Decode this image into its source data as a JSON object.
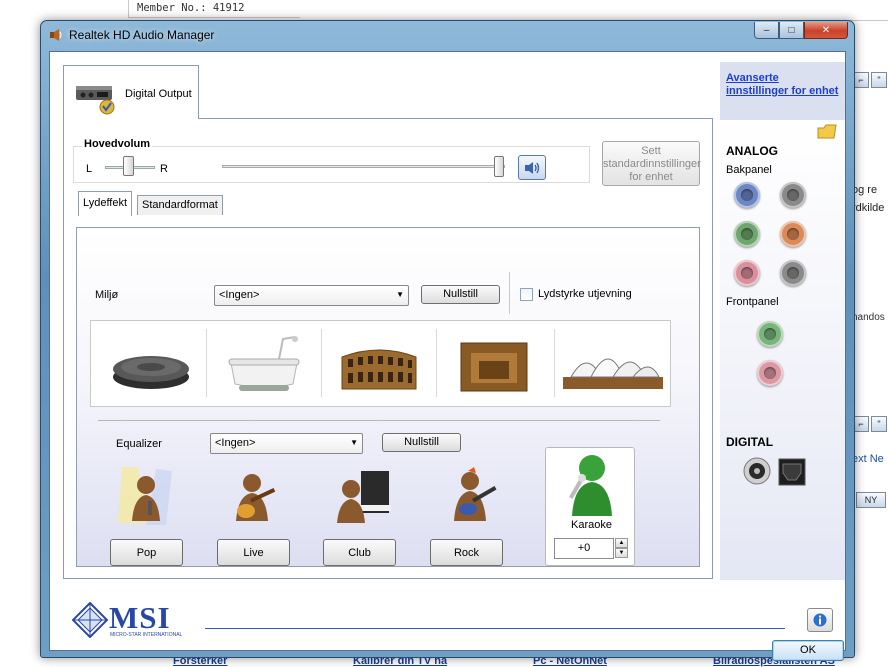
{
  "background_page": {
    "member_text": "Member No.: 41912",
    "right_fragments": [
      "og re",
      "rdkilde",
      "nandos",
      "ext Ne",
      "NY"
    ],
    "footer_links": [
      "Forsterker",
      "Kalibrer din TV nå",
      "Pc - NetOnNet",
      "Bilradiospesialisten AS"
    ]
  },
  "window": {
    "title": "Realtek HD Audio Manager",
    "caption_minimize": "–",
    "caption_maximize": "□",
    "caption_close": "✕"
  },
  "device": {
    "tab_label": "Digital Output"
  },
  "volume": {
    "legend": "Hovedvolum",
    "left_label": "L",
    "right_label": "R",
    "balance_level": 0.5,
    "master_level": 1.0,
    "set_default_button": "Sett standardinnstillinger for enhet"
  },
  "tabs": {
    "effect": "Lydeffekt",
    "format": "Standardformat"
  },
  "environment": {
    "label": "Miljø",
    "value": "<Ingen>",
    "reset_button": "Nullstill",
    "loudness_label": "Lydstyrke utjevning",
    "loudness_checked": false,
    "presets": [
      "disc-stone",
      "bathtub",
      "colosseum",
      "stone-room",
      "opera-house"
    ]
  },
  "equalizer": {
    "label": "Equalizer",
    "value": "<Ingen>",
    "reset_button": "Nullstill",
    "presets": [
      "Pop",
      "Live",
      "Club",
      "Rock"
    ]
  },
  "karaoke": {
    "label": "Karaoke",
    "value": "+0"
  },
  "right_panel": {
    "advanced_link": "Avanserte innstillinger for enhet",
    "analog_title": "ANALOG",
    "back_panel_label": "Bakpanel",
    "front_panel_label": "Frontpanel",
    "digital_title": "DIGITAL",
    "jack_colors": {
      "blue": "#6c87c4",
      "gray": "#8a8a8a",
      "green": "#6fa66f",
      "orange": "#dc8a5a",
      "pink": "#d98f9c",
      "front_green": "#78b47c",
      "front_pink": "#dc98a4"
    }
  },
  "footer": {
    "brand": "MSI",
    "brand_sub": "MICRO-STAR INTERNATIONAL",
    "ok_button": "OK",
    "info_button": "i"
  },
  "colors": {
    "title_bar": "#6f9ec5",
    "link": "#1b3fd0",
    "brand_blue": "#2947a8"
  }
}
